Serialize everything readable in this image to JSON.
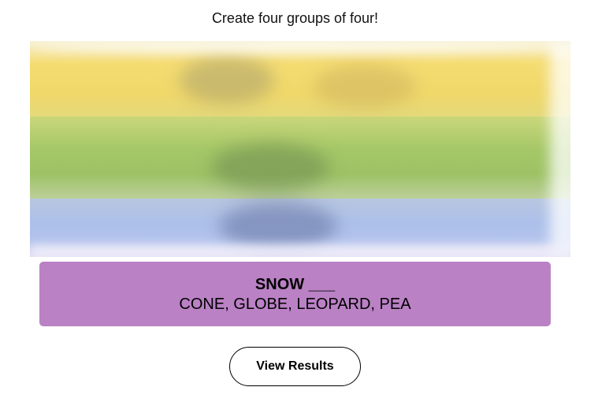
{
  "instructions": "Create four groups of four!",
  "board": {
    "state": "blurred",
    "band_colors": [
      "#f5dc72",
      "#a5c767",
      "#b2c3ec"
    ]
  },
  "solved_group": {
    "title": "SNOW ___",
    "members": "CONE, GLOBE, LEOPARD, PEA",
    "color": "#ba81c5"
  },
  "actions": {
    "view_results_label": "View Results"
  }
}
